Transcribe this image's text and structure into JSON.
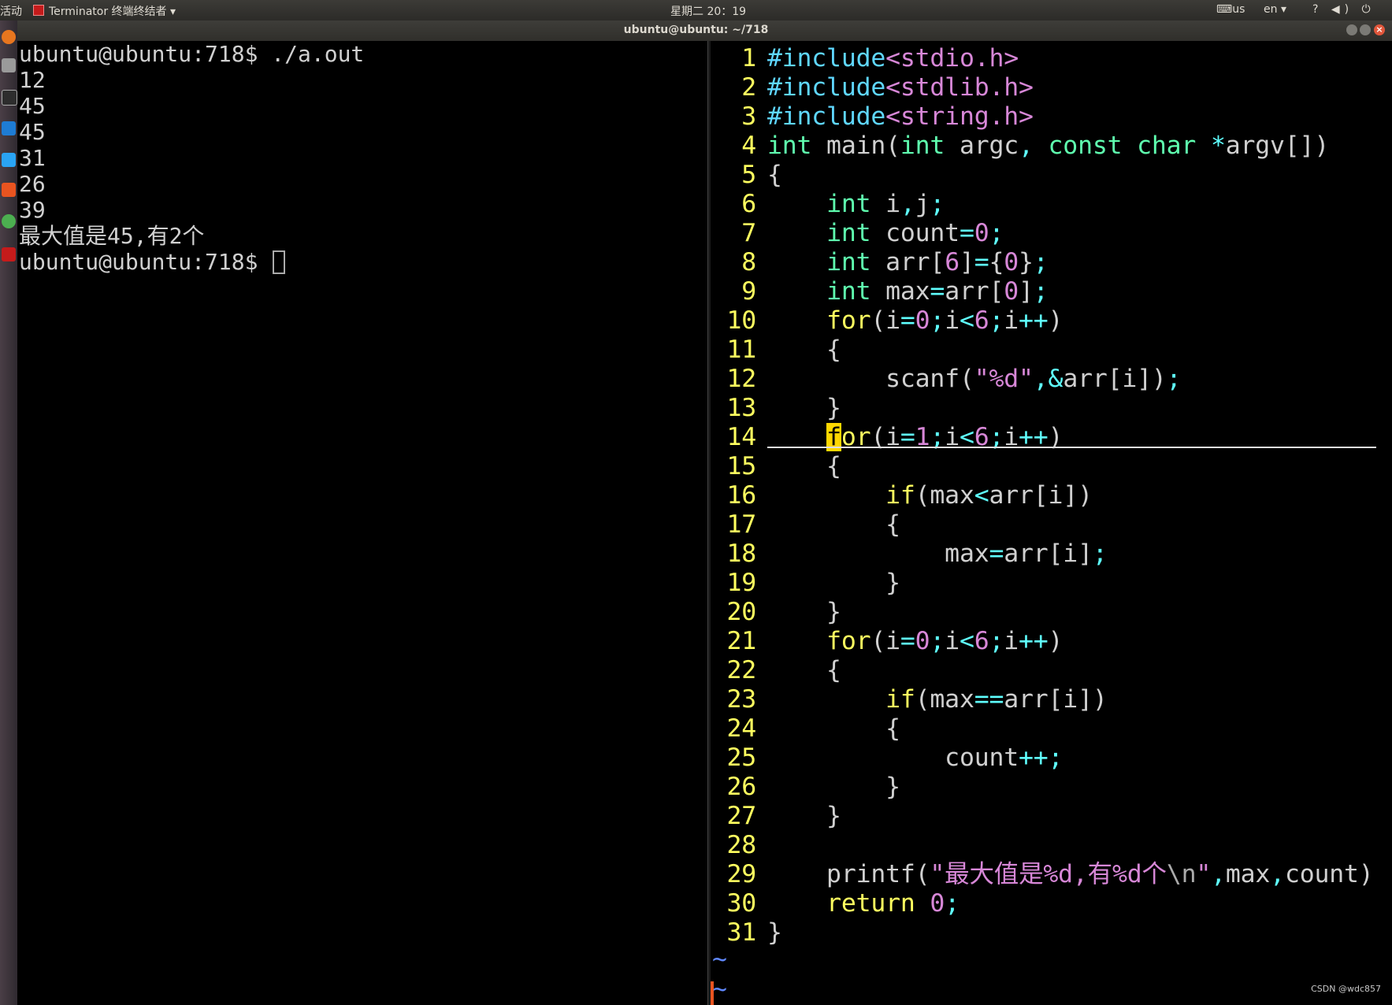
{
  "top_panel": {
    "activities": "活动",
    "app_menu": "Terminator 终端终结者",
    "clock": "星期二 20：19",
    "keyboard": "us",
    "lang": "en",
    "tray": "? ◀) ⏻"
  },
  "window": {
    "title": "ubuntu@ubuntu: ~/718"
  },
  "terminal": {
    "lines": [
      "ubuntu@ubuntu:718$ ./a.out",
      "12",
      "45",
      "45",
      "31",
      "26",
      "39",
      "最大值是45,有2个"
    ],
    "prompt": "ubuntu@ubuntu:718$ "
  },
  "editor": {
    "line_numbers": [
      "1",
      "2",
      "3",
      "4",
      "5",
      "6",
      "7",
      "8",
      "9",
      "10",
      "11",
      "12",
      "13",
      "14",
      "15",
      "16",
      "17",
      "18",
      "19",
      "20",
      "21",
      "22",
      "23",
      "24",
      "25",
      "26",
      "27",
      "28",
      "29",
      "30",
      "31"
    ],
    "empty_marker": "~"
  },
  "colors": {
    "line_number": "#ffff5f",
    "keyword": "#ffff5f",
    "type": "#5fffaf",
    "preprocessor": "#5fd7ff",
    "string": "#d787d7",
    "operator": "#5fffff",
    "cursor": "#ffd700"
  },
  "watermark": "CSDN @wdc857"
}
